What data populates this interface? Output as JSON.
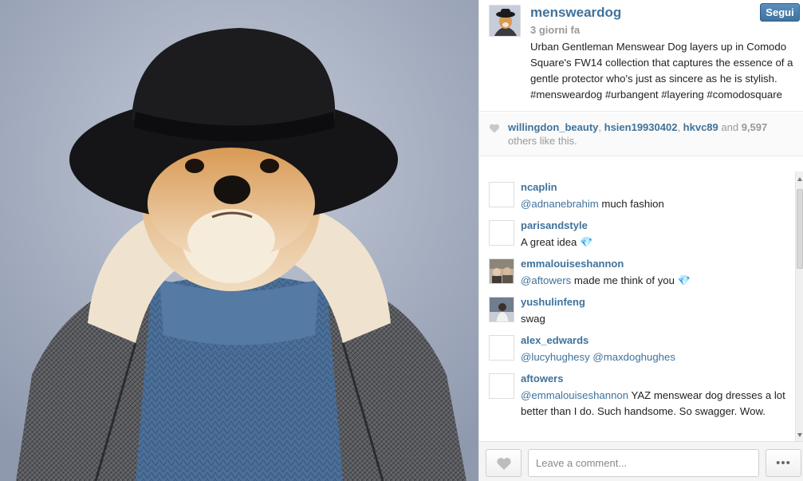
{
  "post": {
    "username": "mensweardog",
    "time_ago": "3 giorni fa",
    "follow_label": "Segui",
    "caption": "Urban Gentleman Menswear Dog layers up in Comodo Square's FW14 collection that captures the essence of a gentle protector who's just as sincere as he is stylish. #mensweardog #urbangent #layering #comodosquare"
  },
  "likes": {
    "user1": "willingdon_beauty",
    "sep1": ", ",
    "user2": "hsien19930402",
    "sep2": ", ",
    "user3": "hkvc89",
    "and_text": " and ",
    "count": "9,597",
    "suffix": " others like this."
  },
  "comments": [
    {
      "user": "ncaplin",
      "mention": "@adnanebrahim",
      "text": " much fashion"
    },
    {
      "user": "parisandstyle",
      "mention": "",
      "text": "A great idea 💎"
    },
    {
      "user": "emmalouiseshannon",
      "mention": "@aftowers",
      "text": " made me think of you 💎"
    },
    {
      "user": "yushulinfeng",
      "mention": "",
      "text": "swag"
    },
    {
      "user": "alex_edwards",
      "mention": "@lucyhughesy @maxdoghughes",
      "text": ""
    },
    {
      "user": "aftowers",
      "mention": "@emmalouiseshannon",
      "text": " YAZ menswear dog dresses a lot better than I do. Such handsome. So swagger. Wow."
    }
  ],
  "footer": {
    "comment_placeholder": "Leave a comment...",
    "more_label": "•••"
  },
  "icons": {
    "like": "heart-icon",
    "more": "more-options-icon"
  },
  "colors": {
    "link": "#3f729b",
    "follow_button": "#3f729b"
  }
}
